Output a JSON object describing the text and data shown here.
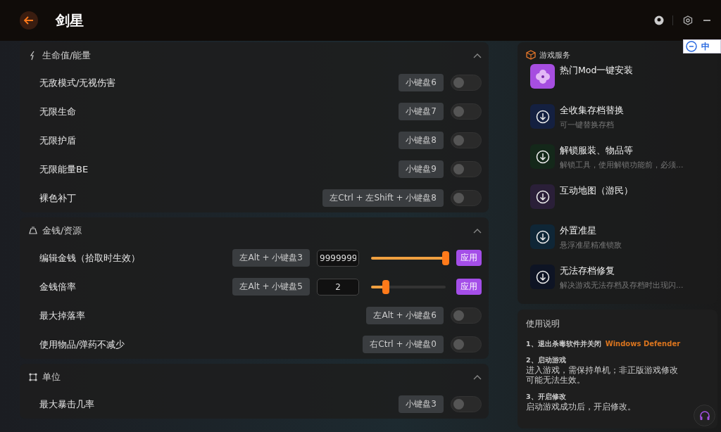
{
  "header": {
    "title": "剑星"
  },
  "ime_bar": {
    "label": "中"
  },
  "sections": [
    {
      "title": "生命值/能量",
      "expanded": true,
      "rows": [
        {
          "kind": "toggle",
          "label": "无敌模式/无视伤害",
          "hotkey": "小键盘6",
          "on": false
        },
        {
          "kind": "toggle",
          "label": "无限生命",
          "hotkey": "小键盘7",
          "on": false
        },
        {
          "kind": "toggle",
          "label": "无限护盾",
          "hotkey": "小键盘8",
          "on": false
        },
        {
          "kind": "toggle",
          "label": "无限能量BE",
          "hotkey": "小键盘9",
          "on": false
        },
        {
          "kind": "toggle",
          "label": "裸色补丁",
          "hotkey": "左Ctrl + 左Shift + 小键盘8",
          "on": false
        }
      ]
    },
    {
      "title": "金钱/资源",
      "expanded": true,
      "rows": [
        {
          "kind": "slider",
          "label": "编辑金钱（拾取时生效）",
          "hotkey": "左Alt + 小键盘3",
          "value": "9999999",
          "level": 1.0,
          "button": "应用"
        },
        {
          "kind": "slider",
          "label": "金钱倍率",
          "hotkey": "左Alt + 小键盘5",
          "value": "2",
          "level": 0.2,
          "button": "应用"
        },
        {
          "kind": "toggle",
          "label": "最大掉落率",
          "hotkey": "左Alt + 小键盘6",
          "on": false
        },
        {
          "kind": "toggle",
          "label": "使用物品/弹药不减少",
          "hotkey": "右Ctrl + 小键盘0",
          "on": false
        }
      ]
    },
    {
      "title": "单位",
      "expanded": true,
      "rows": [
        {
          "kind": "toggle",
          "label": "最大暴击几率",
          "hotkey": "小键盘3",
          "on": false
        }
      ]
    }
  ],
  "services": {
    "title": "游戏服务",
    "items": [
      {
        "kind": "mod",
        "title": "热门Mod一键安装",
        "color": "#a64ee0"
      },
      {
        "kind": "download",
        "title": "全收集存档替换",
        "subtitle": "可一键替换存档",
        "color": "#142040"
      },
      {
        "kind": "download",
        "title": "解锁服装、物品等",
        "subtitle": "解锁工具，使用解锁功能前，必须...",
        "color": "#14281a"
      },
      {
        "kind": "download",
        "title": "互动地图（游民）",
        "color": "#2a1f38"
      },
      {
        "kind": "download",
        "title": "外置准星",
        "subtitle": "悬浮准星精准锁敌",
        "color": "#0f2636"
      },
      {
        "kind": "download",
        "title": "无法存档修复",
        "subtitle": "解决游戏无法存档及存档时出现闪...",
        "color": "#0e1424"
      }
    ]
  },
  "instructions": {
    "title": "使用说明",
    "steps": [
      {
        "heading": "1、退出杀毒软件并关闭",
        "link": "Windows Defender"
      },
      {
        "heading": "2、启动游戏",
        "text": "进入游戏，需保持单机；非正版游戏修改可能无法生效。"
      },
      {
        "heading": "3、开启修改",
        "text": "启动游戏成功后，开启修改。"
      }
    ]
  }
}
